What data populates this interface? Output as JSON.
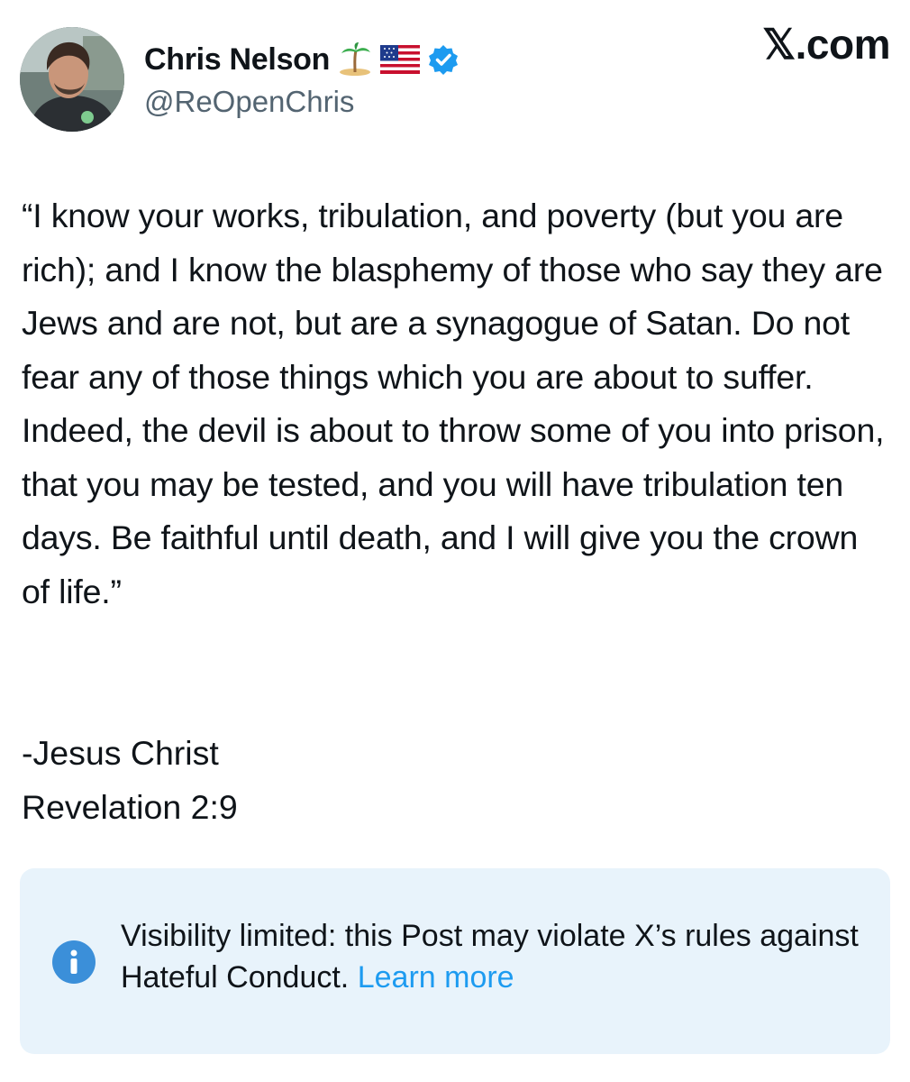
{
  "author": {
    "display_name": "Chris Nelson",
    "handle": "@ReOpenChris",
    "badges": [
      "island-emoji",
      "us-flag-emoji",
      "verified-badge-icon"
    ]
  },
  "brand": {
    "label": "𝕏.com"
  },
  "post": {
    "text": "“I know your works, tribulation, and poverty (but you are rich); and I know the blasphemy of those who say they are Jews and are not, but are a synagogue of Satan. Do not fear any of those things which you are about to suffer. Indeed, the devil is about to throw some of you into prison, that you may be tested, and you will have tribulation ten days. Be faithful until death, and I will give you the crown of life.”",
    "attribution_line1": "-Jesus Christ",
    "attribution_line2": "Revelation 2:9"
  },
  "notice": {
    "text": "Visibility limited: this Post may violate X’s rules against Hateful Conduct.",
    "link_label": "Learn more",
    "icon": "info-icon"
  },
  "colors": {
    "link": "#1d9bf0",
    "notice_bg": "#e8f3fb",
    "secondary_text": "#536471",
    "verified": "#1d9bf0"
  }
}
